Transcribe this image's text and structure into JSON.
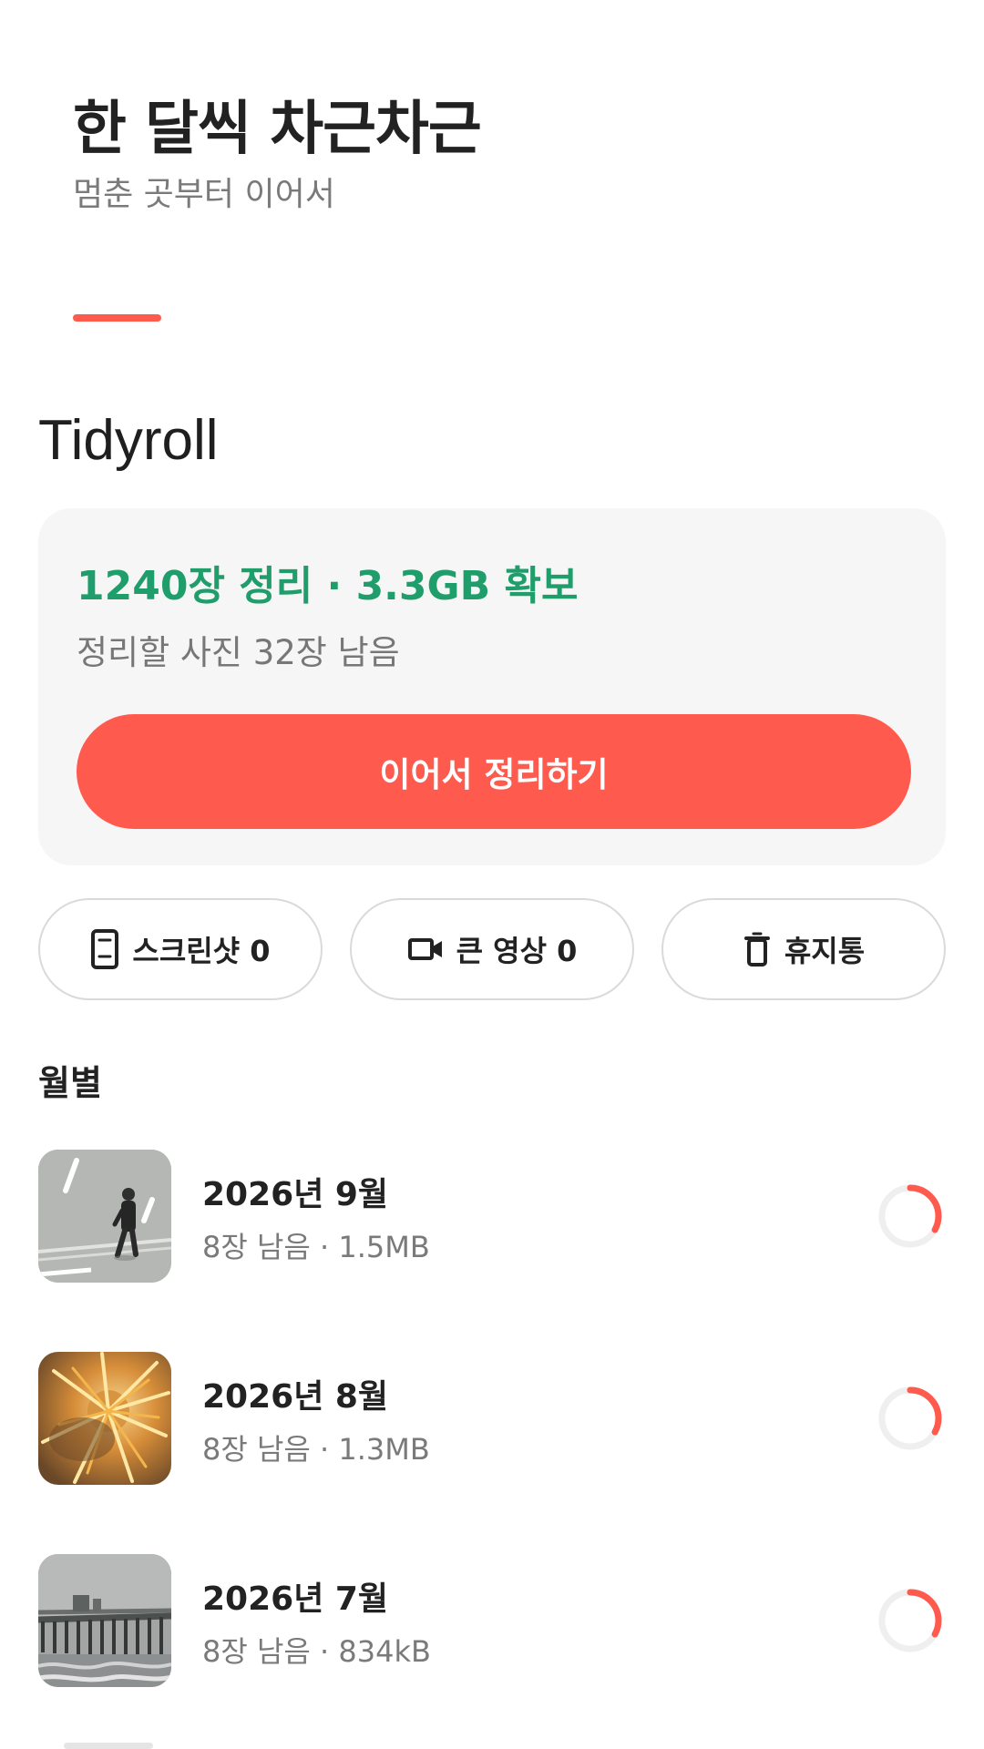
{
  "header": {
    "title": "한 달씩 차근차근",
    "subtitle": "멈춘 곳부터 이어서"
  },
  "app": {
    "name": "Tidyroll"
  },
  "summary": {
    "stats": "1240장 정리 · 3.3GB 확보",
    "remaining": "정리할 사진 32장 남음",
    "continue_label": "이어서 정리하기"
  },
  "chips": {
    "screenshots": "스크린샷 0",
    "large_videos": "큰 영상 0",
    "trash": "휴지통"
  },
  "monthly": {
    "section_title": "월별",
    "months": [
      {
        "title": "2026년 9월",
        "meta": "8장 남음 · 1.5MB",
        "progress": 0.33
      },
      {
        "title": "2026년 8월",
        "meta": "8장 남음 · 1.3MB",
        "progress": 0.33
      },
      {
        "title": "2026년 7월",
        "meta": "8장 남음 · 834kB",
        "progress": 0.33
      }
    ]
  },
  "colors": {
    "accent": "#ff5a4e",
    "success": "#1f9d6b",
    "ring_track": "#efefef",
    "card_background": "#f6f6f6"
  },
  "icons": {
    "screenshots": "phone-icon",
    "large_videos": "video-camera-icon",
    "trash": "trash-icon"
  }
}
